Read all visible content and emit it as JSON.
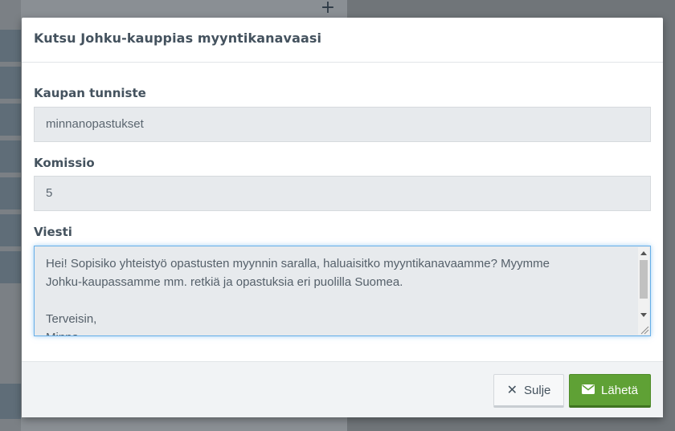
{
  "modal": {
    "title": "Kutsu Johku-kauppias myyntikanavaasi"
  },
  "form": {
    "store_id": {
      "label": "Kaupan tunniste",
      "value": "minnanopastukset"
    },
    "commission": {
      "label": "Komissio",
      "value": "5"
    },
    "message": {
      "label": "Viesti",
      "lines": [
        "Hei! Sopisiko yhteistyö opastusten myynnin saralla, haluaisitko myyntikanavaamme? Myymme",
        "Johku-kaupassamme mm. retkiä ja opastuksia eri puolilla Suomea.",
        "",
        "Terveisin,",
        "Minna"
      ]
    }
  },
  "footer": {
    "close_label": "Sulje",
    "send_label": "Lähetä"
  },
  "icons": {
    "close": "close-icon",
    "send": "envelope-icon",
    "background_add": "plus-icon"
  },
  "colors": {
    "send_button": "#5fa135",
    "focus_border": "#66afe9",
    "title_text": "#44525e"
  },
  "background": {
    "add_symbol": "+"
  }
}
